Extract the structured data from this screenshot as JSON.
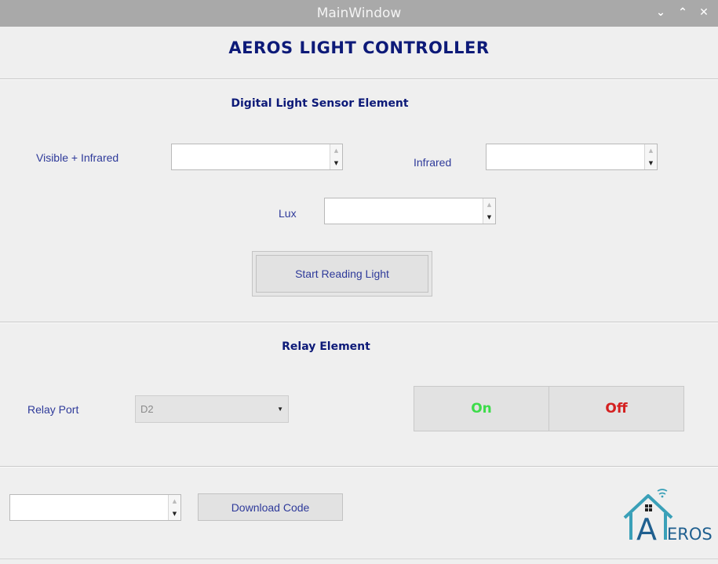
{
  "window": {
    "title": "MainWindow",
    "controls": {
      "minimize_glyph": "⌄",
      "maximize_glyph": "⌃",
      "close_glyph": "✕"
    }
  },
  "header": {
    "title": "AEROS LIGHT CONTROLLER"
  },
  "sensor_section": {
    "title": "Digital Light Sensor Element",
    "visible_infrared": {
      "label": "Visible + Infrared",
      "value": ""
    },
    "infrared": {
      "label": "Infrared",
      "value": ""
    },
    "lux": {
      "label": "Lux",
      "value": ""
    },
    "start_button": "Start Reading Light"
  },
  "relay_section": {
    "title": "Relay Element",
    "port_label": "Relay Port",
    "port_value": "D2",
    "on_label": "On",
    "off_label": "Off"
  },
  "footer": {
    "code_value": "",
    "download_button": "Download Code"
  },
  "logo": {
    "text": "EROS",
    "letter": "A"
  },
  "colors": {
    "heading": "#0d1a78",
    "label": "#2e3a9a",
    "on": "#3ddc4a",
    "off": "#d42020",
    "logo": "#3aa0b8"
  }
}
